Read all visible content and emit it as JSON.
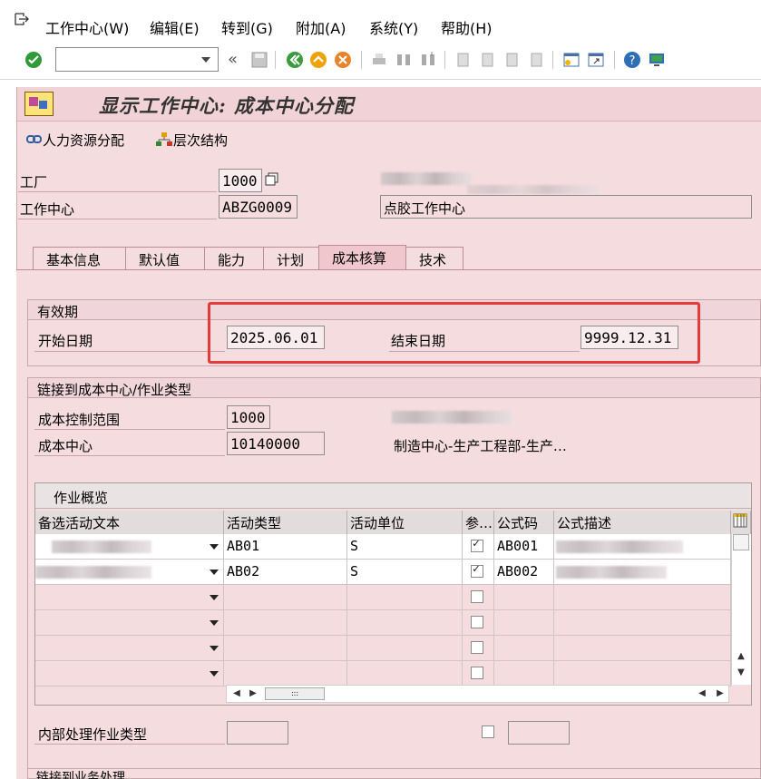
{
  "menu": {
    "items": [
      "工作中心(W)",
      "编辑(E)",
      "转到(G)",
      "附加(A)",
      "系统(Y)",
      "帮助(H)"
    ]
  },
  "toolbar": {
    "command_value": ""
  },
  "title": "显示工作中心: 成本中心分配",
  "appbar": {
    "hr": "人力资源分配",
    "hier": "层次结构"
  },
  "header": {
    "plant_label": "工厂",
    "plant_value": "1000",
    "wc_label": "工作中心",
    "wc_value": "ABZG0009",
    "wc_desc": "点胶工作中心"
  },
  "tabs": [
    "基本信息",
    "默认值",
    "能力",
    "计划",
    "成本核算",
    "技术"
  ],
  "validity": {
    "title": "有效期",
    "start_label": "开始日期",
    "start_value": "2025.06.01",
    "end_label": "结束日期",
    "end_value": "9999.12.31"
  },
  "link": {
    "title": "链接到成本中心/作业类型",
    "ca_label": "成本控制范围",
    "ca_value": "1000",
    "cc_label": "成本中心",
    "cc_value": "10140000",
    "cc_desc": "制造中心-生产工程部-生产…"
  },
  "grid": {
    "title": "作业概览",
    "headers": [
      "备选活动文本",
      "活动类型",
      "活动单位",
      "参…",
      "公式码",
      "公式描述"
    ],
    "rows": [
      {
        "type": "AB01",
        "unit": "S",
        "ref": true,
        "formula": "AB001"
      },
      {
        "type": "AB02",
        "unit": "S",
        "ref": true,
        "formula": "AB002"
      },
      {
        "type": "",
        "unit": "",
        "ref": false,
        "formula": ""
      },
      {
        "type": "",
        "unit": "",
        "ref": false,
        "formula": ""
      },
      {
        "type": "",
        "unit": "",
        "ref": false,
        "formula": ""
      },
      {
        "type": "",
        "unit": "",
        "ref": false,
        "formula": ""
      }
    ]
  },
  "bottom": {
    "internal_label": "内部处理作业类型",
    "bottom_partial": "链接到业务处理"
  },
  "colors": {
    "panel": "#f4dcdf",
    "highlight": "#e53a3a",
    "active_tab": "#efc7cd"
  }
}
